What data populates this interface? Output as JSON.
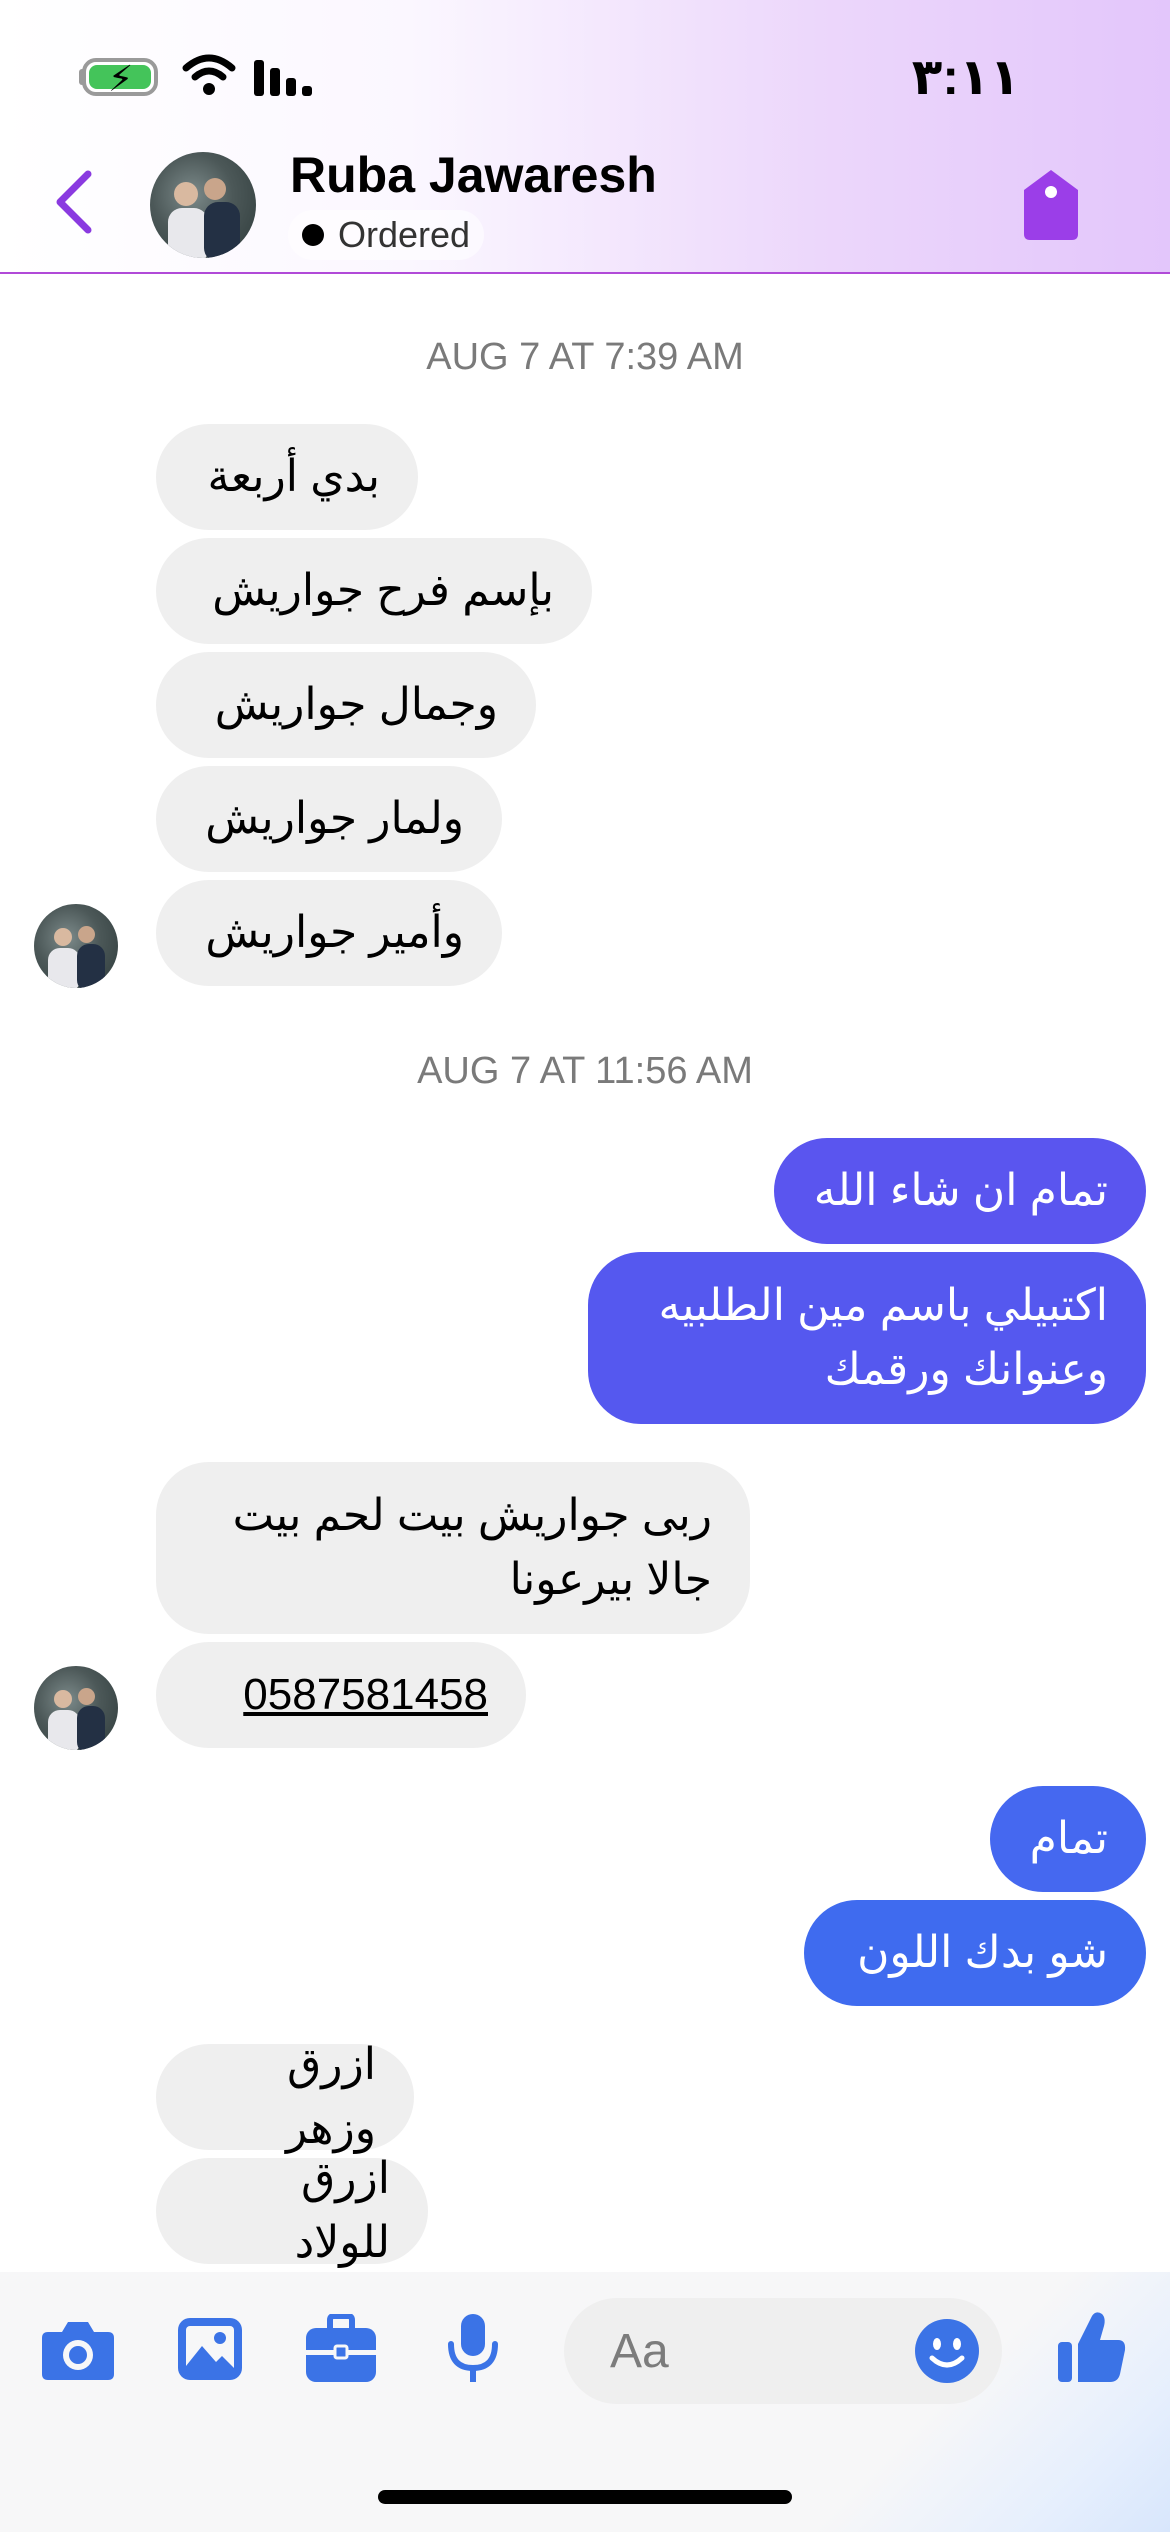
{
  "status_bar": {
    "time": "٣:١١"
  },
  "header": {
    "contact_name": "Ruba Jawaresh",
    "status_label": "Ordered"
  },
  "messages": {
    "ts1": "AUG 7 AT 7:39 AM",
    "in1": "بدي أربعة",
    "in2": "بإسم فرح جواريش",
    "in3": "وجمال جواريش",
    "in4": "ولمار جواريش",
    "in5": "وأمير جواريش",
    "ts2": "AUG 7 AT 11:56 AM",
    "out1": "تمام ان شاء الله",
    "out2_line1": "اكتبيلي باسم مين الطلبيه",
    "out2_line2": "وعنوانك ورقمك",
    "in6_line1": "ربى جواريش بيت لحم بيت",
    "in6_line2": "جالا بيرعونا",
    "in7": "0587581458",
    "out3": "تمام",
    "out4": "شو بدك اللون",
    "in8": "ازرق وزهر",
    "in9": "ازرق للولاد"
  },
  "composer": {
    "placeholder": "Aa"
  },
  "colors": {
    "accent_purple": "#8a3ae0",
    "outgoing_top": "#5a55ef",
    "outgoing_bottom": "#3f6bef",
    "incoming_bg": "#efefef",
    "toolbar_blue": "#3b73e6"
  },
  "icons": [
    "back-icon",
    "tag-icon",
    "camera-icon",
    "image-icon",
    "briefcase-icon",
    "microphone-icon",
    "emoji-icon",
    "like-icon",
    "wifi-icon",
    "signal-icon",
    "battery-icon"
  ]
}
